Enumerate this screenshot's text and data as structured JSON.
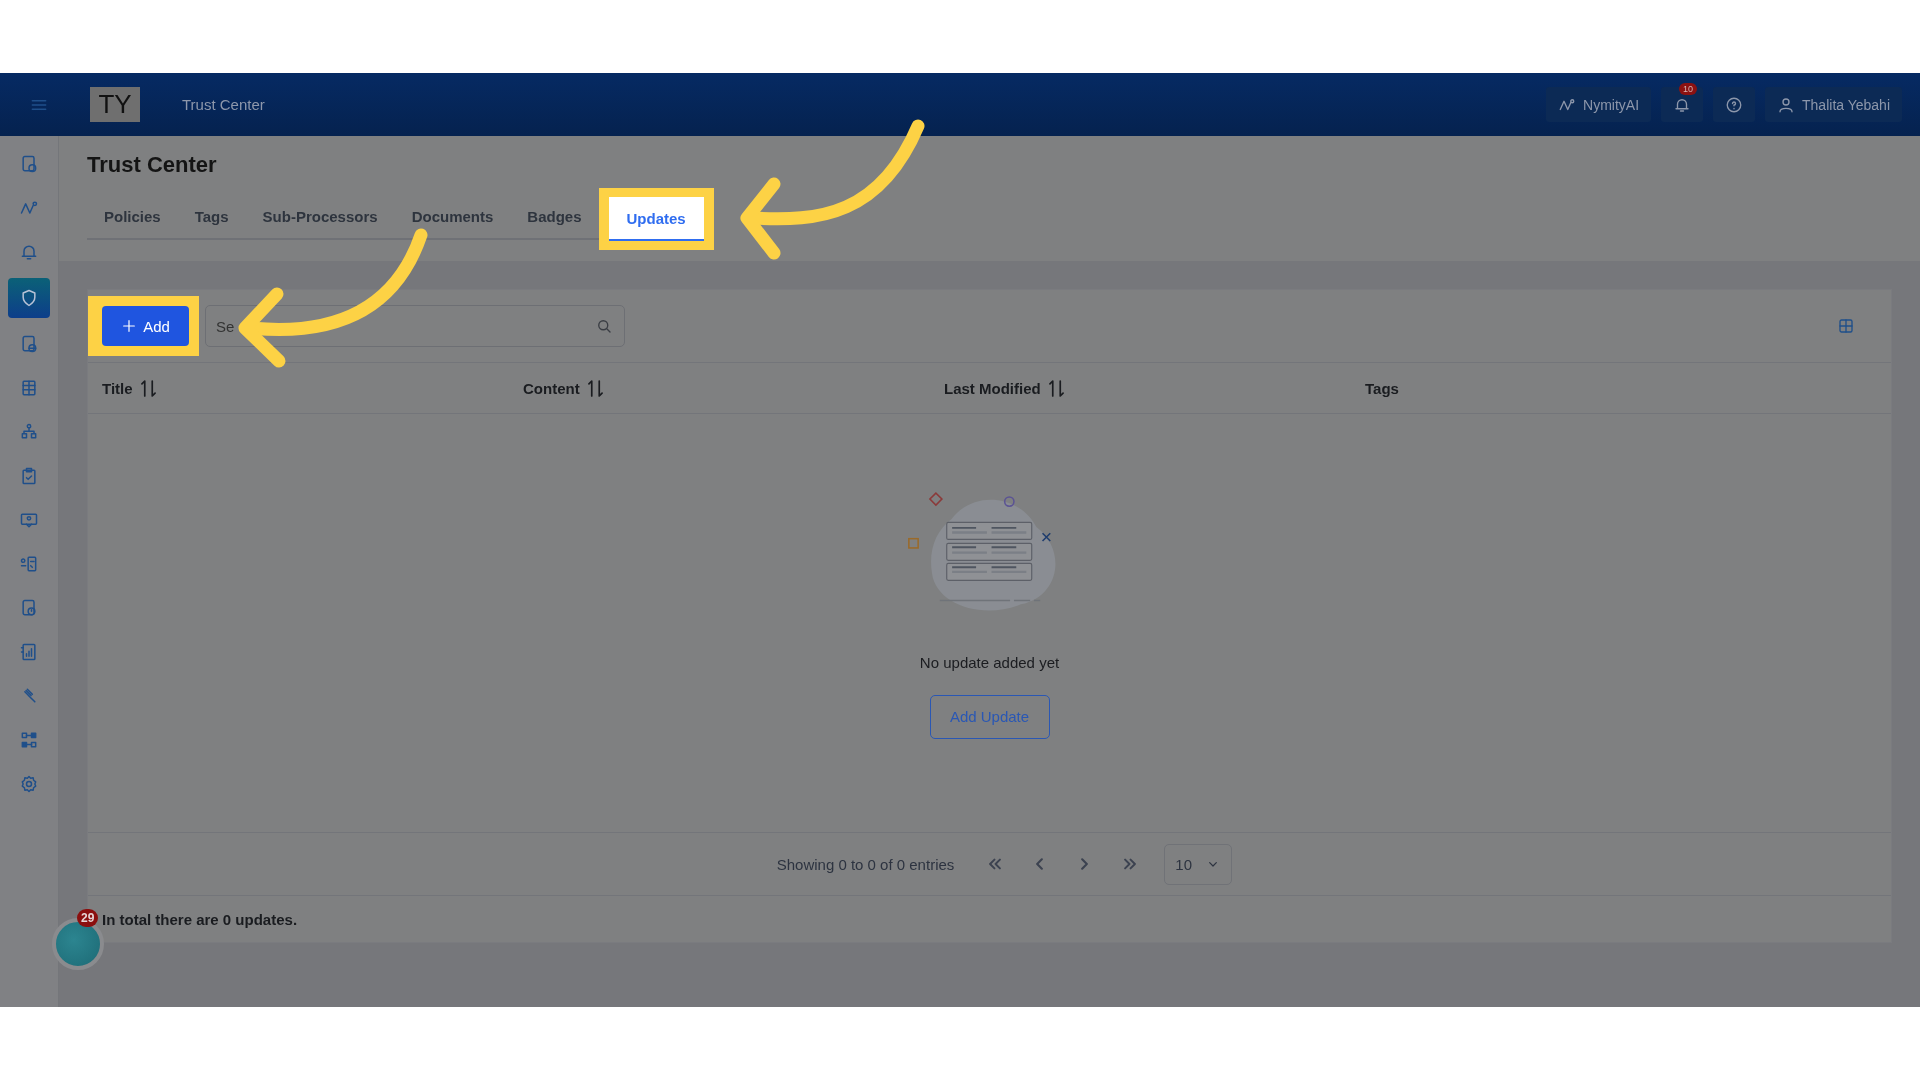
{
  "header": {
    "app_initials": "TY",
    "title": "Trust Center",
    "assistant_label": "NymityAI",
    "notification_count": "10",
    "user_name": "Thalita Yebahi"
  },
  "sidebar": {
    "items": [
      {
        "selected": false
      },
      {
        "selected": false
      },
      {
        "selected": false
      },
      {
        "selected": true
      },
      {
        "selected": false
      },
      {
        "selected": false
      },
      {
        "selected": false
      },
      {
        "selected": false
      },
      {
        "selected": false
      },
      {
        "selected": false
      },
      {
        "selected": false
      },
      {
        "selected": false
      },
      {
        "selected": false
      },
      {
        "selected": false
      },
      {
        "selected": false
      }
    ]
  },
  "page": {
    "title": "Trust Center",
    "tabs": [
      {
        "label": "Policies",
        "selected": false,
        "highlighted": false
      },
      {
        "label": "Tags",
        "selected": false,
        "highlighted": false
      },
      {
        "label": "Sub-Processors",
        "selected": false,
        "highlighted": false
      },
      {
        "label": "Documents",
        "selected": false,
        "highlighted": false
      },
      {
        "label": "Badges",
        "selected": false,
        "highlighted": false
      },
      {
        "label": "Updates",
        "selected": true,
        "highlighted": true
      }
    ]
  },
  "toolbar": {
    "add_button": {
      "label": "Add",
      "highlighted": true
    },
    "search": {
      "placeholder": "Se"
    }
  },
  "table": {
    "columns": [
      {
        "label": "Title",
        "sortable": true
      },
      {
        "label": "Content",
        "sortable": true
      },
      {
        "label": "Last Modified",
        "sortable": true
      },
      {
        "label": "Tags",
        "sortable": false
      }
    ],
    "empty_state": {
      "message": "No update added yet",
      "button": "Add Update"
    }
  },
  "pagination": {
    "summary": "Showing 0 to 0 of 0 entries",
    "page_size": "10"
  },
  "total_text": "In total there are 0 updates.",
  "chat": {
    "badge": "29"
  }
}
